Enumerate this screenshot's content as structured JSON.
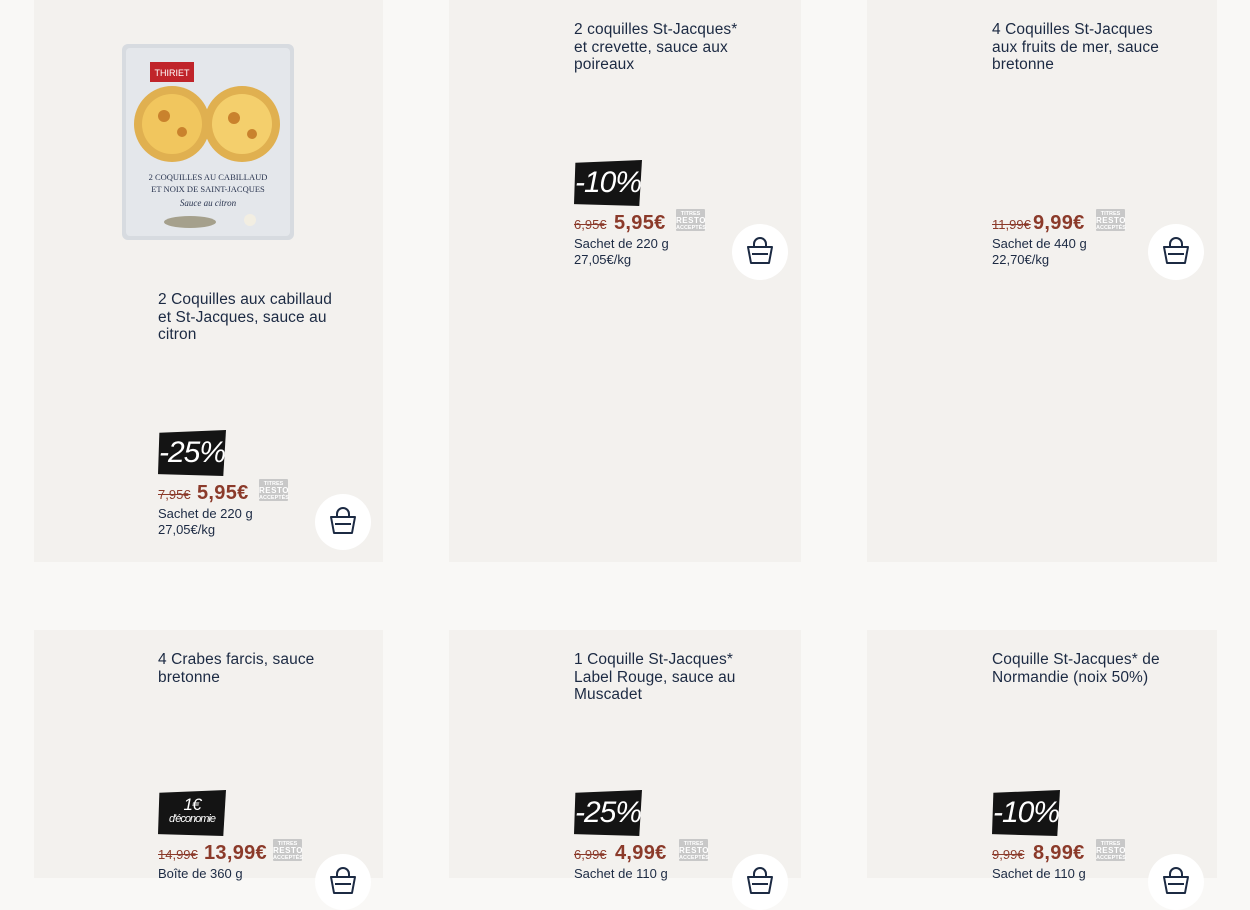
{
  "products": [
    {
      "title_lines": [
        "2 Coquilles aux cabillaud",
        "et St-Jacques, sauce au",
        "citron"
      ],
      "badge": "-25%",
      "old_price": "7,95€",
      "new_price": "5,95€",
      "pack": "Sachet de 220 g",
      "unit_price": "27,05€/kg",
      "has_image": true,
      "image_text": {
        "brand": "THIRIET",
        "line1": "2 COQUILLES AU CABILLAUD",
        "line2": "ET NOIX DE SAINT-JACQUES",
        "line3": "Sauce au citron"
      }
    },
    {
      "title_lines": [
        "2 coquilles St-Jacques*",
        "et crevette, sauce aux",
        "poireaux"
      ],
      "badge": "-10%",
      "old_price": "6,95€",
      "new_price": "5,95€",
      "pack": "Sachet de 220 g",
      "unit_price": "27,05€/kg",
      "has_image": false
    },
    {
      "title_lines": [
        "4 Coquilles St-Jacques",
        "aux fruits de mer, sauce",
        "bretonne"
      ],
      "badge": "",
      "old_price": "11,99€",
      "new_price": "9,99€",
      "pack": "Sachet de 440 g",
      "unit_price": "22,70€/kg",
      "has_image": false
    },
    {
      "title_lines": [
        "4 Crabes farcis, sauce",
        "bretonne"
      ],
      "badge_lines": [
        "1€",
        "d'économie"
      ],
      "old_price": "14,99€",
      "new_price": "13,99€",
      "pack": "Boîte de 360 g",
      "has_image": false
    },
    {
      "title_lines": [
        "1 Coquille St-Jacques*",
        "Label Rouge, sauce au",
        "Muscadet"
      ],
      "badge": "-25%",
      "old_price": "6,99€",
      "new_price": "4,99€",
      "pack": "Sachet de 110 g",
      "has_image": false
    },
    {
      "title_lines": [
        "Coquille St-Jacques* de",
        "Normandie (noix 50%)"
      ],
      "badge": "-10%",
      "old_price": "9,99€",
      "new_price": "8,99€",
      "pack": "Sachet de 110 g",
      "has_image": false
    }
  ],
  "resto_logo": [
    "TITRES",
    "RESTO",
    "ACCEPTÉS"
  ],
  "icons": {
    "cart": "shopping-bag-icon"
  },
  "colors": {
    "price": "#8b3a2a",
    "badge_bg": "#141414",
    "card_bg": "#f3f1ee",
    "text": "#1c2a43"
  }
}
